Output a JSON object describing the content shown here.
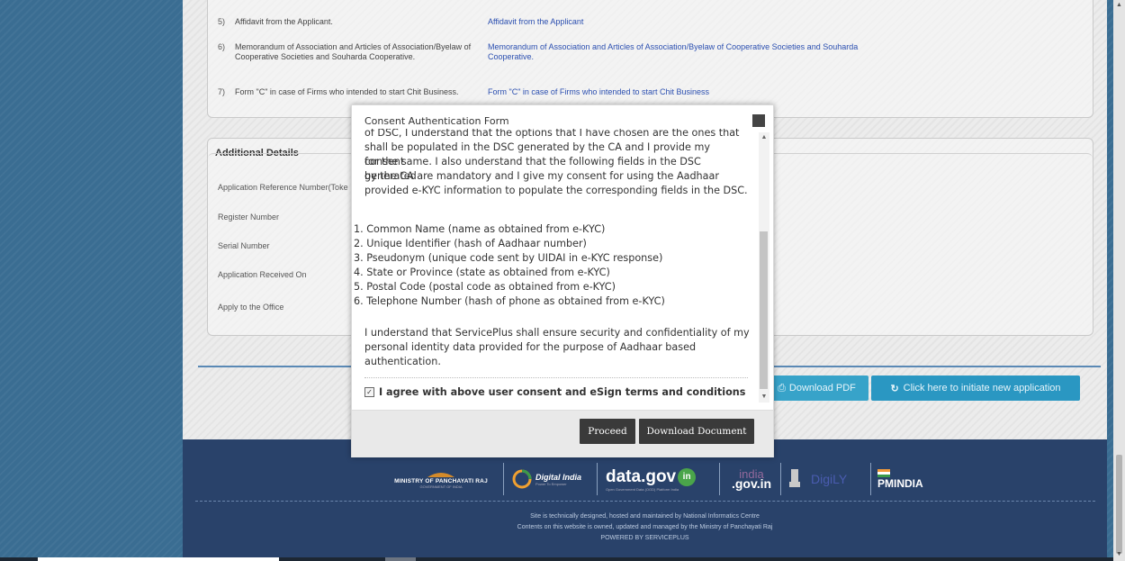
{
  "documents": [
    {
      "num": "5)",
      "name": "Affidavit from the Applicant.",
      "link": "Affidavit from the Applicant"
    },
    {
      "num": "6)",
      "name": "Memorandum of Association and Articles of Association/Byelaw of Cooperative Societies and Souharda Cooperative.",
      "link": "Memorandum of Association and Articles of Association/Byelaw of Cooperative Societies and Souharda Cooperative."
    },
    {
      "num": "7)",
      "name": "Form \"C\" in case of Firms who intended to start Chit Business.",
      "link": "Form \"C\" in case of Firms who intended to start Chit Business"
    }
  ],
  "additional": {
    "title": "Additional Details",
    "labels": [
      "Application Reference Number(Toke",
      "Register Number",
      "Serial Number",
      "Application Received On",
      "Apply to the Office"
    ]
  },
  "actions": {
    "download_pdf": "Download PDF",
    "new_application": "Click here to initiate new application"
  },
  "modal": {
    "title": "Consent Authentication Form",
    "cut_line": "of DSC, I understand that the options that I have chosen are the ones that",
    "para1": [
      "shall be populated in the DSC generated by the CA and I provide my consent",
      "for the same. I also understand that the following fields in the DSC generated",
      "by the CA are mandatory and I give my consent for using the Aadhaar",
      "provided e-KYC information to populate the corresponding fields in the DSC."
    ],
    "fields": [
      "1. Common Name (name as obtained from e-KYC)",
      "2. Unique Identifier (hash of Aadhaar number)",
      "3. Pseudonym (unique code sent by UIDAI in e-KYC response)",
      "4. State or Province (state as obtained from e-KYC)",
      "5. Postal Code (postal code as obtained from e-KYC)",
      "6. Telephone Number (hash of phone as obtained from e-KYC)"
    ],
    "para2": [
      "I understand that ServicePlus shall ensure security and confidentiality of my",
      "personal identity data provided for the purpose of Aadhaar based",
      "authentication."
    ],
    "agree_label": "I agree with above user consent and eSign terms and conditions",
    "proceed": "Proceed",
    "download_document": "Download Document"
  },
  "footer": {
    "logos": {
      "panchayati": "MINISTRY OF PANCHAYATI RAJ",
      "panchayati_sub": "GOVERNMENT OF INDIA",
      "digital_india": "Digital India",
      "digital_india_sub": "Power To Empower",
      "datagov": "data.gov",
      "datagov_suffix": "in",
      "datagov_sub": "Open Government Data (OGD) Platform India",
      "indiagov": "india",
      "indiagov_suffix": ".gov.in",
      "digidesk": "DigiLY",
      "pmindia": "PMINDIA"
    },
    "lines": [
      "Site is technically designed, hosted and maintained by National Informatics Centre",
      "Contents on this website is owned, updated and managed by the Ministry of Panchayati Raj",
      "POWERED BY SERVICEPLUS"
    ]
  },
  "colors": {
    "footer_bg": "#29426a",
    "button_blue": "#2a97c2",
    "link_blue": "#2b4fb0",
    "modal_button": "#3a3a3a"
  }
}
